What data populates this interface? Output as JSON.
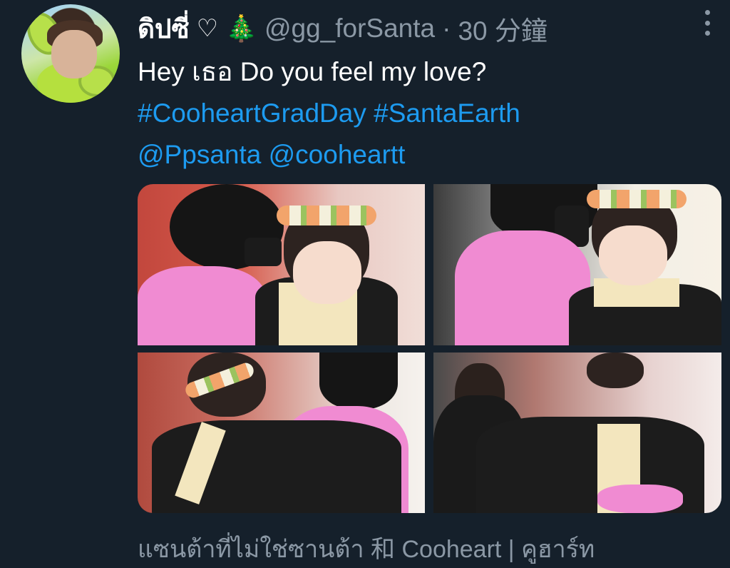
{
  "tweet": {
    "display_name": "ดิปซี่",
    "name_emoji_heart": "♡",
    "name_emoji_tree": "🎄",
    "handle": "@gg_forSanta",
    "separator": "·",
    "time": "30 分鐘",
    "text_line1": "Hey เธอ Do you feel my love?",
    "hashtags": [
      "#CooheartGradDay",
      "#SantaEarth"
    ],
    "mentions": [
      "@Ppsanta",
      "@cooheartt"
    ],
    "footer_text": "แซนต้าที่ไม่ใช่ซานต้า 和 Cooheart | คูฮาร์ท"
  },
  "icons": {
    "more": "more-vertical-icon",
    "tree": "christmas-tree-icon",
    "heart": "heart-outline-icon"
  },
  "colors": {
    "background": "#15202b",
    "link": "#1d9bf0",
    "secondary_text": "#8b98a5",
    "primary_text": "#ffffff"
  }
}
